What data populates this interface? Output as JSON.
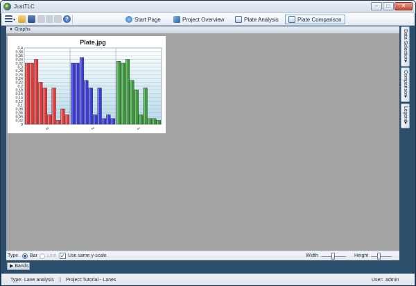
{
  "window": {
    "title": "JustTLC",
    "minimize_glyph": "–",
    "maximize_glyph": "□",
    "close_glyph": "✕"
  },
  "toolbar": {
    "icons": [
      "menu-icon",
      "open-folder-icon",
      "save-icon",
      "cut-icon",
      "copy-icon",
      "paste-icon",
      "help-icon"
    ],
    "help_glyph": "?",
    "nav": {
      "start": "Start Page",
      "overview": "Project Overview",
      "analysis": "Plate Analysis",
      "comparison": "Plate Comparison"
    }
  },
  "graphs_section": {
    "label": "Graphs"
  },
  "chart_data": {
    "type": "bar",
    "title": "Plate.jpg",
    "xlabel": "",
    "ylabel": "",
    "categories": [
      "3",
      "2",
      "1"
    ],
    "group_colors": [
      "#e03a3a",
      "#3a3ad6",
      "#3a9a3a"
    ],
    "groups": [
      {
        "label": "3",
        "values": [
          0.32,
          0.32,
          0.34,
          0.22,
          0.19,
          0.05,
          0.19,
          0.02,
          0.08,
          0.05
        ]
      },
      {
        "label": "2",
        "values": [
          0.32,
          0.32,
          0.35,
          0.23,
          0.19,
          0.05,
          0.19,
          0.03,
          0.05,
          0.03
        ]
      },
      {
        "label": "1",
        "values": [
          0.33,
          0.32,
          0.34,
          0.23,
          0.18,
          0.05,
          0.19,
          0.03,
          0.03,
          0.02
        ]
      }
    ],
    "ylim": [
      0,
      0.4
    ],
    "yticks": [
      "0",
      "0,02",
      "0,04",
      "0,06",
      "0,08",
      "0,1",
      "0,12",
      "0,14",
      "0,16",
      "0,18",
      "0,2",
      "0,22",
      "0,24",
      "0,26",
      "0,28",
      "0,3",
      "0,32",
      "0,34",
      "0,36",
      "0,38",
      "0,4"
    ],
    "grid": true
  },
  "controls": {
    "type_label": "Type",
    "bar_label": "Bar",
    "line_label": "Line",
    "same_scale_label": "Use same y-scale",
    "same_scale_checked": true,
    "check_glyph": "✓",
    "width_label": "Width",
    "width_value": 0.5,
    "height_label": "Height",
    "height_value": 0.4
  },
  "side_tabs": {
    "data_selection": "Data Selection",
    "comparison": "Comparison",
    "legend": "Legend",
    "arrow_glyph": "▼"
  },
  "bands": {
    "label": "Bands",
    "arrow_glyph": "▶"
  },
  "status": {
    "type_label": "Type:",
    "type_value": "Lane analysis",
    "project_label": "Project:",
    "project_value": "Tutorial - Lanes",
    "user_label": "User:",
    "user_value": "admin",
    "separator": "|"
  }
}
